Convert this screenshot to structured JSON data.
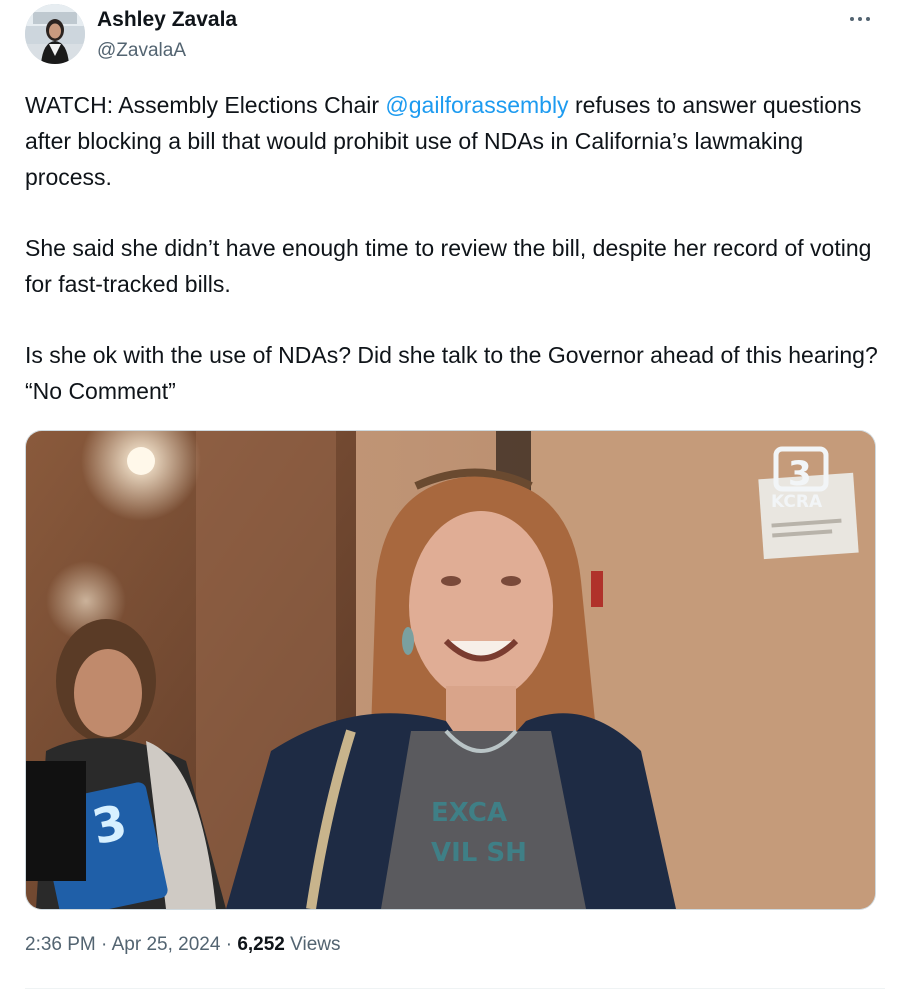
{
  "author": {
    "name": "Ashley Zavala",
    "handle": "@ZavalaA"
  },
  "tweet": {
    "p1_before": "WATCH: Assembly Elections Chair ",
    "p1_mention": "@gailforassembly",
    "p1_after": " refuses to answer questions after blocking a bill that would prohibit use of NDAs in California’s lawmaking process.",
    "p2": "She said she didn’t have enough time to review the bill, despite her record of voting for fast-tracked bills.",
    "p3": "Is she ok with the use of NDAs? Did she talk to the Governor ahead of this hearing? “No Comment”"
  },
  "media": {
    "logo_text": "KCRA",
    "channel_number": "3",
    "shirt_text_1": "EXCA",
    "shirt_text_2": "VIL SH"
  },
  "meta": {
    "time": "2:36 PM",
    "separator": " · ",
    "date": "Apr 25, 2024",
    "views_count": "6,252",
    "views_label": " Views"
  },
  "colors": {
    "link": "#1d9bf0",
    "secondary_text": "#536471",
    "primary_text": "#0f1419"
  },
  "icons": {
    "more": "more-horizontal-icon"
  }
}
